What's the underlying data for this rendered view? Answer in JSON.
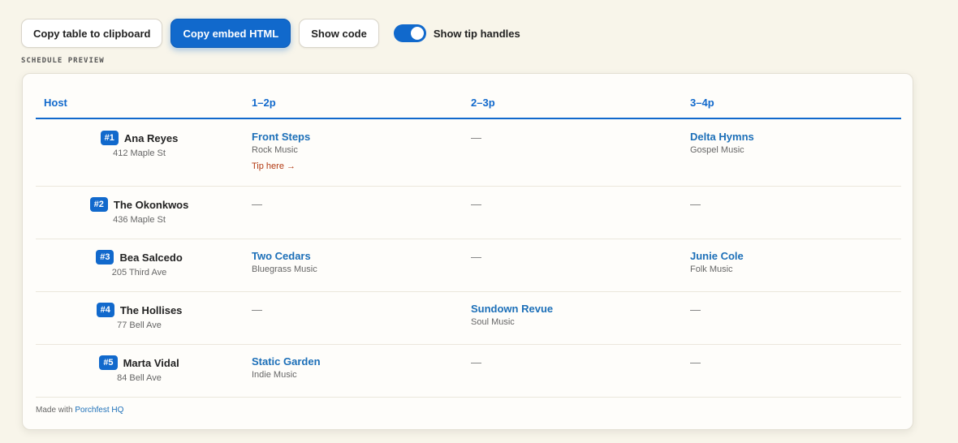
{
  "toolbar": {
    "copy_table_label": "Copy table to clipboard",
    "copy_embed_label": "Copy embed HTML",
    "show_code_label": "Show code",
    "toggle_label": "Show tip handles",
    "toggle_on": true
  },
  "section_label": "SCHEDULE PREVIEW",
  "table": {
    "headers": [
      "Host",
      "1–2p",
      "2–3p",
      "3–4p"
    ],
    "rows": [
      {
        "num": "#1",
        "host": "Ana Reyes",
        "address": "412 Maple St",
        "slots": [
          {
            "name": "Front Steps",
            "genre": "Rock Music",
            "tip": "Tip here →"
          },
          {
            "empty": "—"
          },
          {
            "name": "Delta Hymns",
            "genre": "Gospel Music"
          }
        ]
      },
      {
        "num": "#2",
        "host": "The Okonkwos",
        "address": "436 Maple St",
        "slots": [
          {
            "empty": "—"
          },
          {
            "empty": "—"
          },
          {
            "empty": "—"
          }
        ]
      },
      {
        "num": "#3",
        "host": "Bea Salcedo",
        "address": "205 Third Ave",
        "slots": [
          {
            "name": "Two Cedars",
            "genre": "Bluegrass Music"
          },
          {
            "empty": "—"
          },
          {
            "name": "Junie Cole",
            "genre": "Folk Music"
          }
        ]
      },
      {
        "num": "#4",
        "host": "The Hollises",
        "address": "77 Bell Ave",
        "slots": [
          {
            "empty": "—"
          },
          {
            "name": "Sundown Revue",
            "genre": "Soul Music"
          },
          {
            "empty": "—"
          }
        ]
      },
      {
        "num": "#5",
        "host": "Marta Vidal",
        "address": "84 Bell Ave",
        "slots": [
          {
            "name": "Static Garden",
            "genre": "Indie Music"
          },
          {
            "empty": "—"
          },
          {
            "empty": "—"
          }
        ]
      }
    ]
  },
  "footer": {
    "prefix": "Made with ",
    "link": "Porchfest HQ"
  },
  "colors": {
    "accent": "#1169cc",
    "tip": "#b23a12",
    "background": "#f8f5ea"
  }
}
